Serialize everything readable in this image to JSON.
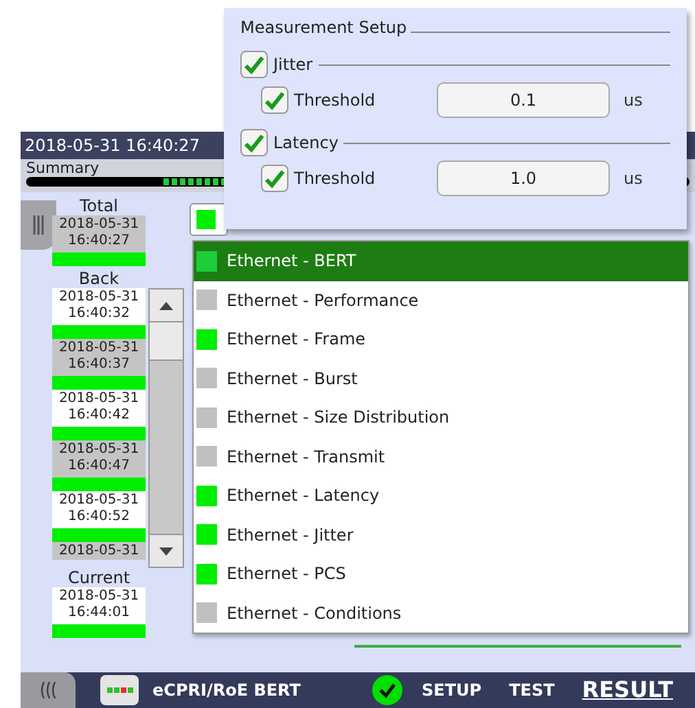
{
  "header": {
    "timestamp": "2018-05-31 16:40:27"
  },
  "summary": {
    "label": "Summary"
  },
  "history": {
    "total": {
      "label": "Total",
      "date": "2018-05-31",
      "time": "16:40:27"
    },
    "back": {
      "label": "Back",
      "entries": [
        {
          "date": "2018-05-31",
          "time": "16:40:32"
        },
        {
          "date": "2018-05-31",
          "time": "16:40:37"
        },
        {
          "date": "2018-05-31",
          "time": "16:40:42"
        },
        {
          "date": "2018-05-31",
          "time": "16:40:47"
        },
        {
          "date": "2018-05-31",
          "time": "16:40:52"
        },
        {
          "date": "2018-05-31"
        }
      ]
    },
    "current": {
      "label": "Current",
      "date": "2018-05-31",
      "time": "16:44:01"
    }
  },
  "measurement_setup": {
    "title": "Measurement Setup",
    "groups": [
      {
        "label": "Jitter",
        "checked": true,
        "threshold": {
          "label": "Threshold",
          "checked": true,
          "value": "0.1",
          "unit": "us"
        }
      },
      {
        "label": "Latency",
        "checked": true,
        "threshold": {
          "label": "Threshold",
          "checked": true,
          "value": "1.0",
          "unit": "us"
        }
      }
    ]
  },
  "result_menu": {
    "items": [
      {
        "label": "Ethernet - BERT",
        "color": "#1fcc3a",
        "selected": true
      },
      {
        "label": "Ethernet - Performance",
        "color": "#c0c0c0",
        "selected": false
      },
      {
        "label": "Ethernet - Frame",
        "color": "#00ee00",
        "selected": false
      },
      {
        "label": "Ethernet - Burst",
        "color": "#c0c0c0",
        "selected": false
      },
      {
        "label": "Ethernet - Size Distribution",
        "color": "#c0c0c0",
        "selected": false
      },
      {
        "label": "Ethernet - Transmit",
        "color": "#c0c0c0",
        "selected": false
      },
      {
        "label": "Ethernet - Latency",
        "color": "#00ee00",
        "selected": false
      },
      {
        "label": "Ethernet - Jitter",
        "color": "#00ee00",
        "selected": false
      },
      {
        "label": "Ethernet - PCS",
        "color": "#00ee00",
        "selected": false
      },
      {
        "label": "Ethernet - Conditions",
        "color": "#c0c0c0",
        "selected": false
      }
    ]
  },
  "bottom_bar": {
    "app_name": "eCPRI/RoE BERT",
    "tabs": [
      {
        "label": "SETUP",
        "selected": false
      },
      {
        "label": "TEST",
        "selected": false
      },
      {
        "label": "RESULT",
        "selected": true
      }
    ]
  }
}
